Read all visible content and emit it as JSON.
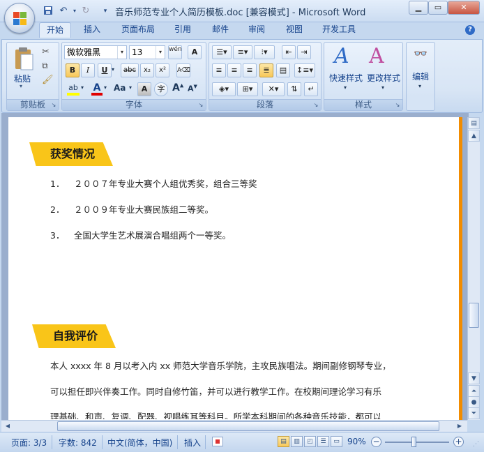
{
  "window": {
    "title": "音乐师范专业个人简历模板.doc [兼容模式] - Microsoft Word",
    "minimize_icon": "minimize-icon",
    "maximize_icon": "maximize-icon",
    "close_icon": "close-icon"
  },
  "quick_access": {
    "save_icon": "save-icon",
    "undo_icon": "undo-icon",
    "redo_icon": "redo-icon",
    "customize_icon": "dropdown-icon"
  },
  "tabs": [
    {
      "label": "开始",
      "active": true
    },
    {
      "label": "插入"
    },
    {
      "label": "页面布局"
    },
    {
      "label": "引用"
    },
    {
      "label": "邮件"
    },
    {
      "label": "审阅"
    },
    {
      "label": "视图"
    },
    {
      "label": "开发工具"
    }
  ],
  "ribbon": {
    "clipboard": {
      "label": "剪贴板",
      "paste_label": "粘贴"
    },
    "font": {
      "label": "字体",
      "font_name": "微软雅黑",
      "font_size": "13",
      "bold": "B",
      "italic": "I",
      "underline": "U",
      "strike": "abc",
      "subscript": "x₂",
      "superscript": "x²",
      "change_case": "Aa",
      "grow": "A",
      "shrink": "A",
      "wen": "wén",
      "accent_colors": {
        "highlight": "#ffff00",
        "font_color": "#e00000"
      }
    },
    "paragraph": {
      "label": "段落"
    },
    "styles": {
      "label": "样式",
      "quick_styles": "快速样式",
      "change_styles": "更改样式"
    },
    "editing": {
      "label": "编辑"
    }
  },
  "document": {
    "section1": {
      "heading": "获奖情况",
      "items": [
        {
          "num": "1．",
          "text": "２００７年专业大赛个人组优秀奖，组合三等奖"
        },
        {
          "num": "2．",
          "text": "２００９年专业大赛民族组二等奖。"
        },
        {
          "num": "3．",
          "text": "全国大学生艺术展演合唱组两个一等奖。"
        }
      ]
    },
    "section2": {
      "heading": "自我评价",
      "lines": [
        "本人 xxxx 年 8 月以考入内 xx 师范大学音乐学院，主攻民族唱法。期间副修钢琴专业，",
        "可以担任即兴伴奏工作。同时自修竹笛，并可以进行教学工作。在校期间理论学习有乐",
        "理基础、和声、复调、配器、视唱练耳等科目。所学本科期间的各种音乐技能，都可以"
      ]
    },
    "colors": {
      "banner": "#f9c519",
      "side_bar": "#f28c00"
    }
  },
  "status": {
    "page": "页面: 3/3",
    "words": "字数: 842",
    "language": "中文(简体，中国)",
    "mode": "插入",
    "zoom": "90%",
    "zoom_out": "−",
    "zoom_in": "+"
  }
}
